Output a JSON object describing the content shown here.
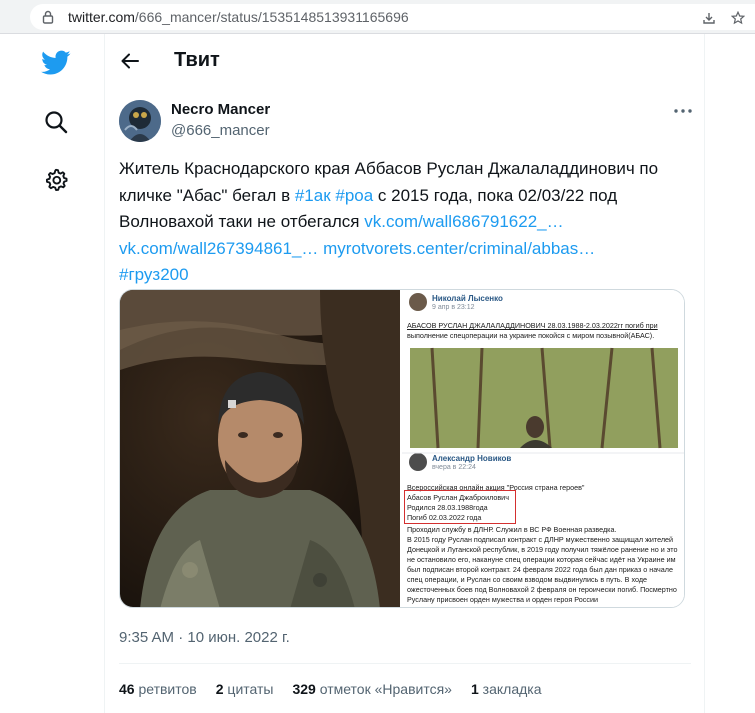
{
  "browser": {
    "url_domain": "twitter.com",
    "url_path": "/666_mancer/status/1535148513931165696"
  },
  "header": {
    "title": "Твит"
  },
  "tweet": {
    "display_name": "Necro Mancer",
    "handle": "@666_mancer",
    "text": {
      "part1": "Житель Краснодарского края Аббасов Руслан Джалаладдинович по кличке \"Абас\" бегал в ",
      "tag1": "#1ак",
      "part2": " ",
      "tag2": "#роа",
      "part3": " с 2015 года, пока 02/03/22 под Волновахой таки не отбегался ",
      "link1": "vk.com/wall686791622_…",
      "link2": "vk.com/wall267394861_…",
      "link3": "myrotvorets.center/criminal/abbas…",
      "tag3": "#груз200"
    },
    "timestamp": "9:35 AM · 10 июн. 2022 г.",
    "stats": {
      "retweets_count": "46",
      "retweets_label": "ретвитов",
      "quotes_count": "2",
      "quotes_label": "цитаты",
      "likes_count": "329",
      "likes_label": "отметок «Нравится»",
      "bookmarks_count": "1",
      "bookmarks_label": "закладка"
    }
  },
  "media_screenshot": {
    "post1_author": "Николай Лысенко",
    "post1_time": "9 апр в 23:12",
    "post1_line1": "АБАСОВ РУСЛАН ДЖАЛАЛАДДИНОВИЧ 28.03.1988-2.03.2022гг погиб при",
    "post1_line2": "выполнение спецоперации на украине покойся с миром позывной(АБАС).",
    "post2_author": "Александр Новиков",
    "post2_time": "вчера в 22:24",
    "post2_heading": "Всероссийская онлайн акция \"Россия страна героев\"",
    "post2_name": "Абасов Руслан Джаброилович",
    "post2_born": "Родился 28.03.1988года",
    "post2_died": "Погиб 02.03.2022 года",
    "post2_body": [
      "Проходил службу в ДЛНР. Служил в ВС РФ Военная разведка.",
      "В 2015 году Руслан подписал контракт с ДЛНР мужественно защищал жителей",
      "Донецкой и Луганской республик, в 2019 году получил тяжёлое ранение но и это",
      "не остановило его, накануне спец операции которая сейчас идёт на Украине им",
      "был подписан второй контракт. 24 февраля 2022 года был дан приказ о начале",
      "спец операции, и Руслан со своим взводом выдвинулись в путь. В ходе",
      "ожесточенных боев под Волновахой 2 февраля он героически погиб. Посмертно",
      "Руслану присвоен орден мужества и орден героя России"
    ]
  },
  "colors": {
    "accent": "#1d9bf0",
    "text_primary": "#0f1419",
    "text_secondary": "#536471",
    "border": "#eff3f4"
  },
  "icons": {
    "logo": "twitter-bird-icon",
    "search": "search-icon",
    "settings": "gear-icon",
    "back": "arrow-left-icon",
    "more": "more-dots-icon",
    "lock": "lock-icon",
    "download": "download-icon",
    "star": "star-icon"
  }
}
